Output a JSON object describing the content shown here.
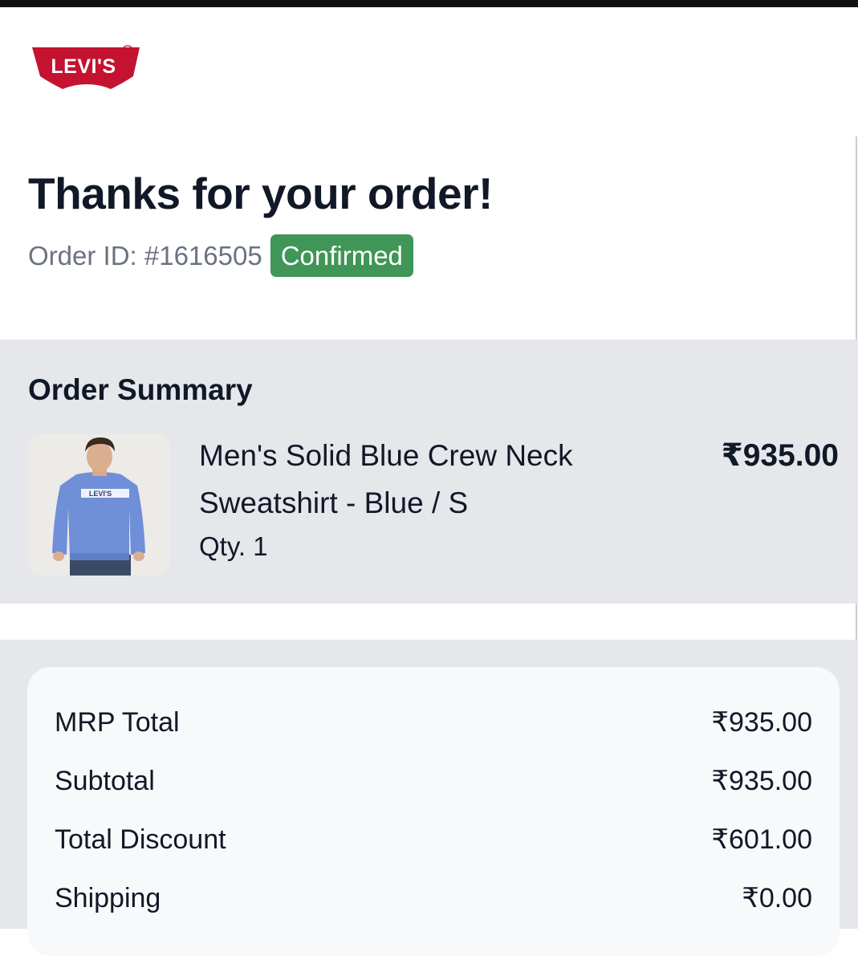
{
  "brand": {
    "logo_text": "Levi's"
  },
  "header": {
    "title": "Thanks for your order!",
    "order_id": "Order ID: #1616505",
    "status": "Confirmed"
  },
  "summary": {
    "heading": "Order Summary",
    "item": {
      "name": "Men's Solid Blue Crew Neck Sweatshirt - Blue / S",
      "qty": "Qty. 1",
      "price": "₹935.00"
    }
  },
  "totals": [
    {
      "label": "MRP Total",
      "value": "₹935.00"
    },
    {
      "label": "Subtotal",
      "value": "₹935.00"
    },
    {
      "label": "Total Discount",
      "value": "₹601.00"
    },
    {
      "label": "Shipping",
      "value": "₹0.00"
    }
  ],
  "colors": {
    "brand_red": "#c41230",
    "status_green": "#3f9657",
    "section_gray": "#e5e7eb",
    "card_bg": "#f8f9fb"
  }
}
